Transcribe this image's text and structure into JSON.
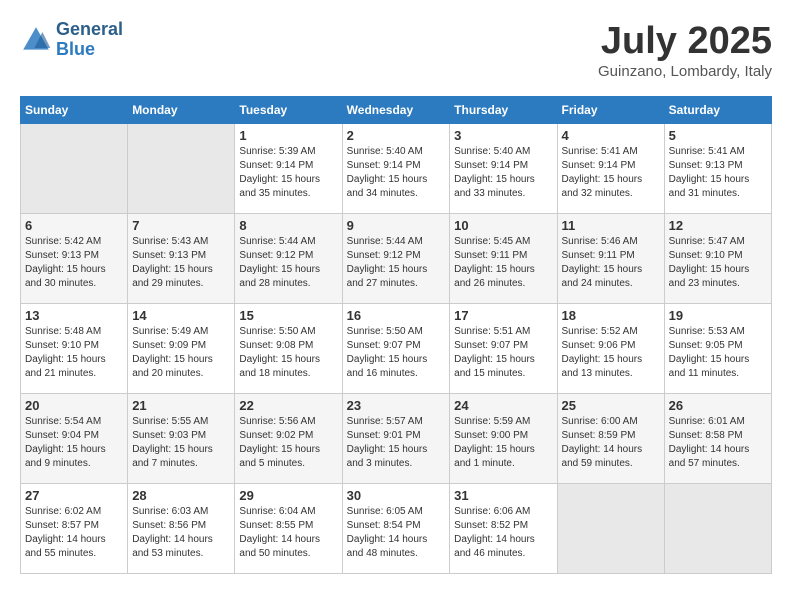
{
  "header": {
    "logo_line1": "General",
    "logo_line2": "Blue",
    "month": "July 2025",
    "location": "Guinzano, Lombardy, Italy"
  },
  "weekdays": [
    "Sunday",
    "Monday",
    "Tuesday",
    "Wednesday",
    "Thursday",
    "Friday",
    "Saturday"
  ],
  "weeks": [
    [
      {
        "day": "",
        "sunrise": "",
        "sunset": "",
        "daylight": ""
      },
      {
        "day": "",
        "sunrise": "",
        "sunset": "",
        "daylight": ""
      },
      {
        "day": "1",
        "sunrise": "Sunrise: 5:39 AM",
        "sunset": "Sunset: 9:14 PM",
        "daylight": "Daylight: 15 hours and 35 minutes."
      },
      {
        "day": "2",
        "sunrise": "Sunrise: 5:40 AM",
        "sunset": "Sunset: 9:14 PM",
        "daylight": "Daylight: 15 hours and 34 minutes."
      },
      {
        "day": "3",
        "sunrise": "Sunrise: 5:40 AM",
        "sunset": "Sunset: 9:14 PM",
        "daylight": "Daylight: 15 hours and 33 minutes."
      },
      {
        "day": "4",
        "sunrise": "Sunrise: 5:41 AM",
        "sunset": "Sunset: 9:14 PM",
        "daylight": "Daylight: 15 hours and 32 minutes."
      },
      {
        "day": "5",
        "sunrise": "Sunrise: 5:41 AM",
        "sunset": "Sunset: 9:13 PM",
        "daylight": "Daylight: 15 hours and 31 minutes."
      }
    ],
    [
      {
        "day": "6",
        "sunrise": "Sunrise: 5:42 AM",
        "sunset": "Sunset: 9:13 PM",
        "daylight": "Daylight: 15 hours and 30 minutes."
      },
      {
        "day": "7",
        "sunrise": "Sunrise: 5:43 AM",
        "sunset": "Sunset: 9:13 PM",
        "daylight": "Daylight: 15 hours and 29 minutes."
      },
      {
        "day": "8",
        "sunrise": "Sunrise: 5:44 AM",
        "sunset": "Sunset: 9:12 PM",
        "daylight": "Daylight: 15 hours and 28 minutes."
      },
      {
        "day": "9",
        "sunrise": "Sunrise: 5:44 AM",
        "sunset": "Sunset: 9:12 PM",
        "daylight": "Daylight: 15 hours and 27 minutes."
      },
      {
        "day": "10",
        "sunrise": "Sunrise: 5:45 AM",
        "sunset": "Sunset: 9:11 PM",
        "daylight": "Daylight: 15 hours and 26 minutes."
      },
      {
        "day": "11",
        "sunrise": "Sunrise: 5:46 AM",
        "sunset": "Sunset: 9:11 PM",
        "daylight": "Daylight: 15 hours and 24 minutes."
      },
      {
        "day": "12",
        "sunrise": "Sunrise: 5:47 AM",
        "sunset": "Sunset: 9:10 PM",
        "daylight": "Daylight: 15 hours and 23 minutes."
      }
    ],
    [
      {
        "day": "13",
        "sunrise": "Sunrise: 5:48 AM",
        "sunset": "Sunset: 9:10 PM",
        "daylight": "Daylight: 15 hours and 21 minutes."
      },
      {
        "day": "14",
        "sunrise": "Sunrise: 5:49 AM",
        "sunset": "Sunset: 9:09 PM",
        "daylight": "Daylight: 15 hours and 20 minutes."
      },
      {
        "day": "15",
        "sunrise": "Sunrise: 5:50 AM",
        "sunset": "Sunset: 9:08 PM",
        "daylight": "Daylight: 15 hours and 18 minutes."
      },
      {
        "day": "16",
        "sunrise": "Sunrise: 5:50 AM",
        "sunset": "Sunset: 9:07 PM",
        "daylight": "Daylight: 15 hours and 16 minutes."
      },
      {
        "day": "17",
        "sunrise": "Sunrise: 5:51 AM",
        "sunset": "Sunset: 9:07 PM",
        "daylight": "Daylight: 15 hours and 15 minutes."
      },
      {
        "day": "18",
        "sunrise": "Sunrise: 5:52 AM",
        "sunset": "Sunset: 9:06 PM",
        "daylight": "Daylight: 15 hours and 13 minutes."
      },
      {
        "day": "19",
        "sunrise": "Sunrise: 5:53 AM",
        "sunset": "Sunset: 9:05 PM",
        "daylight": "Daylight: 15 hours and 11 minutes."
      }
    ],
    [
      {
        "day": "20",
        "sunrise": "Sunrise: 5:54 AM",
        "sunset": "Sunset: 9:04 PM",
        "daylight": "Daylight: 15 hours and 9 minutes."
      },
      {
        "day": "21",
        "sunrise": "Sunrise: 5:55 AM",
        "sunset": "Sunset: 9:03 PM",
        "daylight": "Daylight: 15 hours and 7 minutes."
      },
      {
        "day": "22",
        "sunrise": "Sunrise: 5:56 AM",
        "sunset": "Sunset: 9:02 PM",
        "daylight": "Daylight: 15 hours and 5 minutes."
      },
      {
        "day": "23",
        "sunrise": "Sunrise: 5:57 AM",
        "sunset": "Sunset: 9:01 PM",
        "daylight": "Daylight: 15 hours and 3 minutes."
      },
      {
        "day": "24",
        "sunrise": "Sunrise: 5:59 AM",
        "sunset": "Sunset: 9:00 PM",
        "daylight": "Daylight: 15 hours and 1 minute."
      },
      {
        "day": "25",
        "sunrise": "Sunrise: 6:00 AM",
        "sunset": "Sunset: 8:59 PM",
        "daylight": "Daylight: 14 hours and 59 minutes."
      },
      {
        "day": "26",
        "sunrise": "Sunrise: 6:01 AM",
        "sunset": "Sunset: 8:58 PM",
        "daylight": "Daylight: 14 hours and 57 minutes."
      }
    ],
    [
      {
        "day": "27",
        "sunrise": "Sunrise: 6:02 AM",
        "sunset": "Sunset: 8:57 PM",
        "daylight": "Daylight: 14 hours and 55 minutes."
      },
      {
        "day": "28",
        "sunrise": "Sunrise: 6:03 AM",
        "sunset": "Sunset: 8:56 PM",
        "daylight": "Daylight: 14 hours and 53 minutes."
      },
      {
        "day": "29",
        "sunrise": "Sunrise: 6:04 AM",
        "sunset": "Sunset: 8:55 PM",
        "daylight": "Daylight: 14 hours and 50 minutes."
      },
      {
        "day": "30",
        "sunrise": "Sunrise: 6:05 AM",
        "sunset": "Sunset: 8:54 PM",
        "daylight": "Daylight: 14 hours and 48 minutes."
      },
      {
        "day": "31",
        "sunrise": "Sunrise: 6:06 AM",
        "sunset": "Sunset: 8:52 PM",
        "daylight": "Daylight: 14 hours and 46 minutes."
      },
      {
        "day": "",
        "sunrise": "",
        "sunset": "",
        "daylight": ""
      },
      {
        "day": "",
        "sunrise": "",
        "sunset": "",
        "daylight": ""
      }
    ]
  ]
}
